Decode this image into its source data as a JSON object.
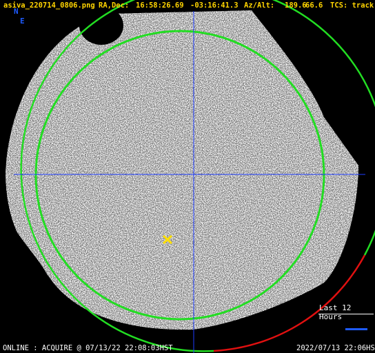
{
  "header": {
    "filename": "asiva_220714_0806.png",
    "radec_label": "RA,Dec:",
    "ra": "16:58:26.69",
    "dec": "-03:16:41.3",
    "azalt_label": "Az/Alt:",
    "az": "189.6",
    "alt": "66.6",
    "tcs": "TCS: track"
  },
  "compass": {
    "north": "N",
    "east": "E"
  },
  "legend": {
    "trail_label": "Last 12 Hours"
  },
  "footer": {
    "status": "ONLINE : ACQUIRE @ 07/13/22 22:08:03HST",
    "timestamp": "2022/07/13 22:06HST"
  },
  "colors": {
    "header_text": "#ffd400",
    "crosshair": "#1e3cff",
    "altitude_circle": "#22dd22",
    "horizon_circle_lit": "#22dd22",
    "horizon_circle_recent": "#e01010",
    "target_marker": "#ffe000",
    "trail_marker": "#1e5bff"
  },
  "icons": {
    "target": "target-x-icon"
  }
}
